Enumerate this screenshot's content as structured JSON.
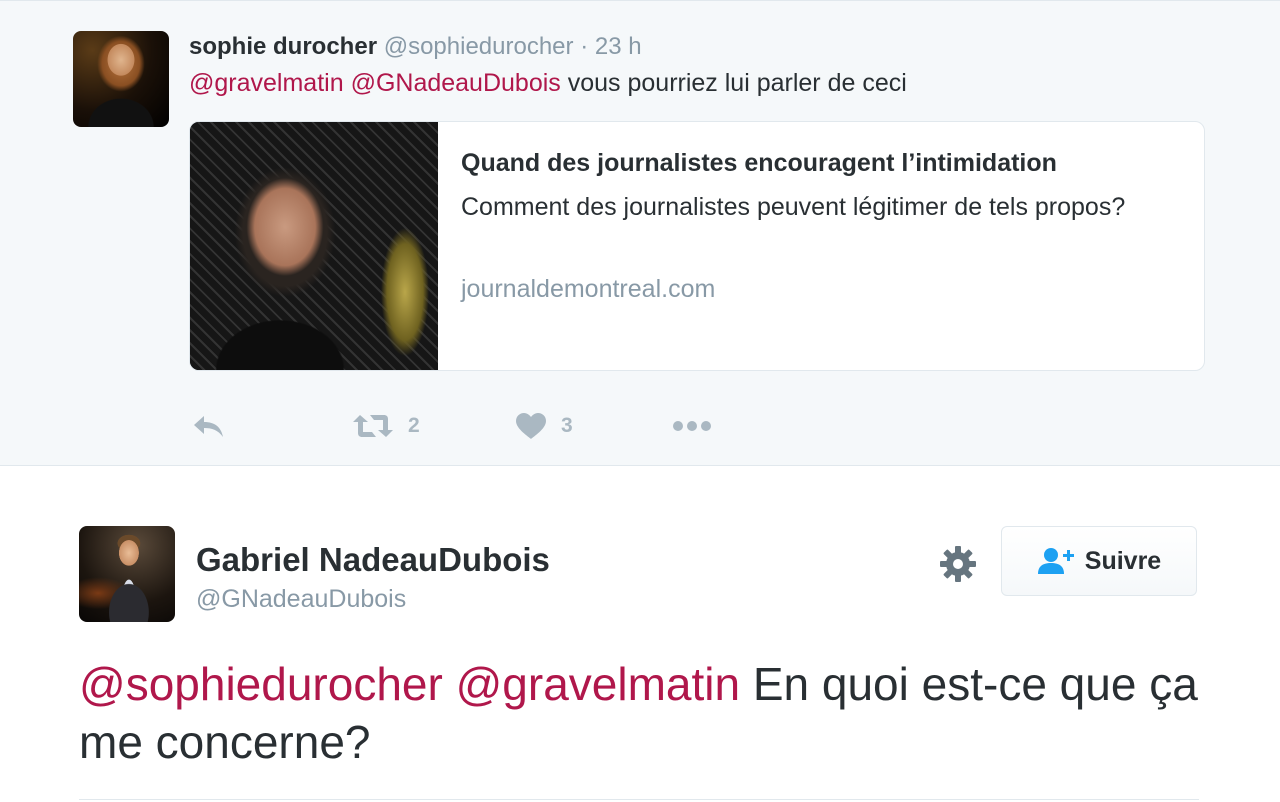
{
  "reply_tweet": {
    "author_name": "sophie durocher",
    "author_handle": "@sophiedurocher",
    "time": "· 23 h",
    "mentions": [
      "@gravelmatin",
      "@GNadeauDubois"
    ],
    "text": "vous pourriez lui parler de ceci",
    "card": {
      "title": "Quand des journalistes encouragent l’intimidation",
      "description": "Comment des journalistes peuvent légitimer de tels propos?",
      "domain": "journaldemontreal.com"
    },
    "actions": {
      "reply_icon": "reply-icon",
      "retweet_icon": "retweet-icon",
      "retweet_count": "2",
      "like_icon": "heart-icon",
      "like_count": "3",
      "more_icon": "more-icon"
    }
  },
  "main_tweet": {
    "author_name": "Gabriel NadeauDubois",
    "author_handle": "@GNadeauDubois",
    "settings_icon": "gear-icon",
    "follow_label": "Suivre",
    "follow_icon": "follow-user-icon",
    "mentions": [
      "@sophiedurocher",
      "@gravelmatin"
    ],
    "text": "En quoi est-ce que ça me concerne?"
  },
  "colors": {
    "mention": "#b0174b",
    "muted": "#8899a6",
    "text": "#292f33",
    "pane_bg": "#f5f8fa",
    "border": "#e1e8ed"
  }
}
